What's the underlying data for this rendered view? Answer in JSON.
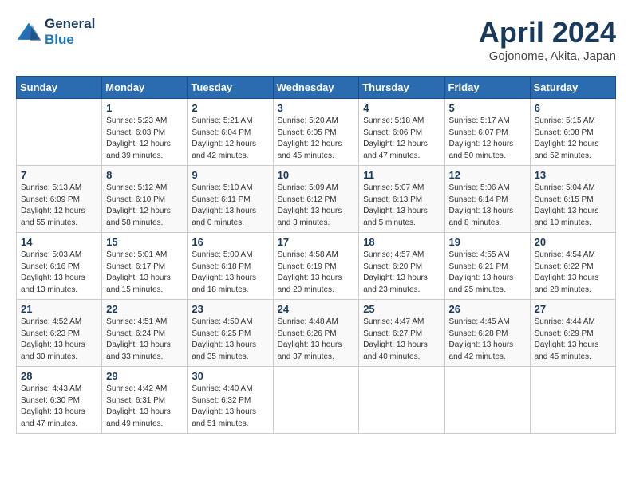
{
  "logo": {
    "line1": "General",
    "line2": "Blue"
  },
  "title": "April 2024",
  "location": "Gojonome, Akita, Japan",
  "headers": [
    "Sunday",
    "Monday",
    "Tuesday",
    "Wednesday",
    "Thursday",
    "Friday",
    "Saturday"
  ],
  "weeks": [
    [
      {
        "day": "",
        "info": ""
      },
      {
        "day": "1",
        "info": "Sunrise: 5:23 AM\nSunset: 6:03 PM\nDaylight: 12 hours\nand 39 minutes."
      },
      {
        "day": "2",
        "info": "Sunrise: 5:21 AM\nSunset: 6:04 PM\nDaylight: 12 hours\nand 42 minutes."
      },
      {
        "day": "3",
        "info": "Sunrise: 5:20 AM\nSunset: 6:05 PM\nDaylight: 12 hours\nand 45 minutes."
      },
      {
        "day": "4",
        "info": "Sunrise: 5:18 AM\nSunset: 6:06 PM\nDaylight: 12 hours\nand 47 minutes."
      },
      {
        "day": "5",
        "info": "Sunrise: 5:17 AM\nSunset: 6:07 PM\nDaylight: 12 hours\nand 50 minutes."
      },
      {
        "day": "6",
        "info": "Sunrise: 5:15 AM\nSunset: 6:08 PM\nDaylight: 12 hours\nand 52 minutes."
      }
    ],
    [
      {
        "day": "7",
        "info": "Sunrise: 5:13 AM\nSunset: 6:09 PM\nDaylight: 12 hours\nand 55 minutes."
      },
      {
        "day": "8",
        "info": "Sunrise: 5:12 AM\nSunset: 6:10 PM\nDaylight: 12 hours\nand 58 minutes."
      },
      {
        "day": "9",
        "info": "Sunrise: 5:10 AM\nSunset: 6:11 PM\nDaylight: 13 hours\nand 0 minutes."
      },
      {
        "day": "10",
        "info": "Sunrise: 5:09 AM\nSunset: 6:12 PM\nDaylight: 13 hours\nand 3 minutes."
      },
      {
        "day": "11",
        "info": "Sunrise: 5:07 AM\nSunset: 6:13 PM\nDaylight: 13 hours\nand 5 minutes."
      },
      {
        "day": "12",
        "info": "Sunrise: 5:06 AM\nSunset: 6:14 PM\nDaylight: 13 hours\nand 8 minutes."
      },
      {
        "day": "13",
        "info": "Sunrise: 5:04 AM\nSunset: 6:15 PM\nDaylight: 13 hours\nand 10 minutes."
      }
    ],
    [
      {
        "day": "14",
        "info": "Sunrise: 5:03 AM\nSunset: 6:16 PM\nDaylight: 13 hours\nand 13 minutes."
      },
      {
        "day": "15",
        "info": "Sunrise: 5:01 AM\nSunset: 6:17 PM\nDaylight: 13 hours\nand 15 minutes."
      },
      {
        "day": "16",
        "info": "Sunrise: 5:00 AM\nSunset: 6:18 PM\nDaylight: 13 hours\nand 18 minutes."
      },
      {
        "day": "17",
        "info": "Sunrise: 4:58 AM\nSunset: 6:19 PM\nDaylight: 13 hours\nand 20 minutes."
      },
      {
        "day": "18",
        "info": "Sunrise: 4:57 AM\nSunset: 6:20 PM\nDaylight: 13 hours\nand 23 minutes."
      },
      {
        "day": "19",
        "info": "Sunrise: 4:55 AM\nSunset: 6:21 PM\nDaylight: 13 hours\nand 25 minutes."
      },
      {
        "day": "20",
        "info": "Sunrise: 4:54 AM\nSunset: 6:22 PM\nDaylight: 13 hours\nand 28 minutes."
      }
    ],
    [
      {
        "day": "21",
        "info": "Sunrise: 4:52 AM\nSunset: 6:23 PM\nDaylight: 13 hours\nand 30 minutes."
      },
      {
        "day": "22",
        "info": "Sunrise: 4:51 AM\nSunset: 6:24 PM\nDaylight: 13 hours\nand 33 minutes."
      },
      {
        "day": "23",
        "info": "Sunrise: 4:50 AM\nSunset: 6:25 PM\nDaylight: 13 hours\nand 35 minutes."
      },
      {
        "day": "24",
        "info": "Sunrise: 4:48 AM\nSunset: 6:26 PM\nDaylight: 13 hours\nand 37 minutes."
      },
      {
        "day": "25",
        "info": "Sunrise: 4:47 AM\nSunset: 6:27 PM\nDaylight: 13 hours\nand 40 minutes."
      },
      {
        "day": "26",
        "info": "Sunrise: 4:45 AM\nSunset: 6:28 PM\nDaylight: 13 hours\nand 42 minutes."
      },
      {
        "day": "27",
        "info": "Sunrise: 4:44 AM\nSunset: 6:29 PM\nDaylight: 13 hours\nand 45 minutes."
      }
    ],
    [
      {
        "day": "28",
        "info": "Sunrise: 4:43 AM\nSunset: 6:30 PM\nDaylight: 13 hours\nand 47 minutes."
      },
      {
        "day": "29",
        "info": "Sunrise: 4:42 AM\nSunset: 6:31 PM\nDaylight: 13 hours\nand 49 minutes."
      },
      {
        "day": "30",
        "info": "Sunrise: 4:40 AM\nSunset: 6:32 PM\nDaylight: 13 hours\nand 51 minutes."
      },
      {
        "day": "",
        "info": ""
      },
      {
        "day": "",
        "info": ""
      },
      {
        "day": "",
        "info": ""
      },
      {
        "day": "",
        "info": ""
      }
    ]
  ]
}
